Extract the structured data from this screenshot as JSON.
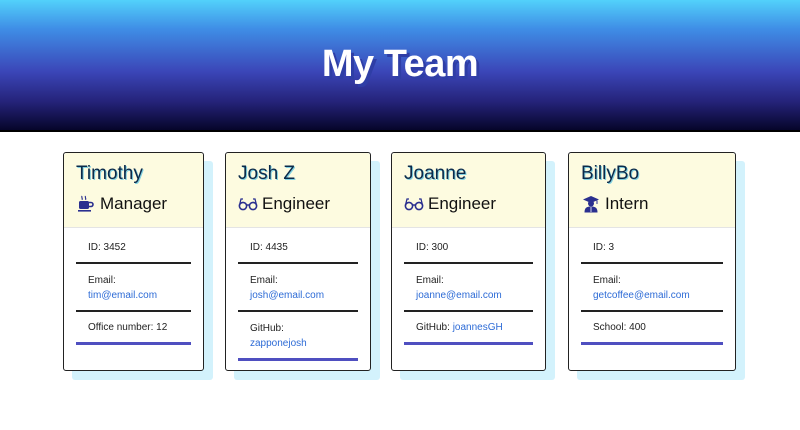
{
  "header": {
    "title": "My Team"
  },
  "colors": {
    "header_gradient_top": "#52d1fb",
    "header_gradient_bottom": "#06052a",
    "card_head_bg": "#fdfbe0",
    "link": "#2d6bd6",
    "last_rule": "#4f4fc0",
    "shadow": "#d3f2fc"
  },
  "cards": [
    {
      "name": "Timothy",
      "role": "Manager",
      "role_icon": "coffee-cup-icon",
      "id_text": "ID: 3452",
      "email_label": "Email:",
      "email": "tim@email.com",
      "extra_label": "Office number: 12",
      "extra_value": ""
    },
    {
      "name": "Josh Z",
      "role": "Engineer",
      "role_icon": "glasses-icon",
      "id_text": "ID: 4435",
      "email_label": "Email:",
      "email": "josh@email.com",
      "extra_label": "GitHub:",
      "extra_value": "zapponejosh"
    },
    {
      "name": "Joanne",
      "role": "Engineer",
      "role_icon": "glasses-icon",
      "id_text": "ID: 300",
      "email_label": "Email:",
      "email": "joanne@email.com",
      "extra_label": "GitHub:",
      "extra_value": "joannesGH"
    },
    {
      "name": "BillyBo",
      "role": "Intern",
      "role_icon": "graduate-icon",
      "id_text": "ID: 3",
      "email_label": "Email:",
      "email": "getcoffee@email.com",
      "extra_label": "School: 400",
      "extra_value": ""
    }
  ]
}
